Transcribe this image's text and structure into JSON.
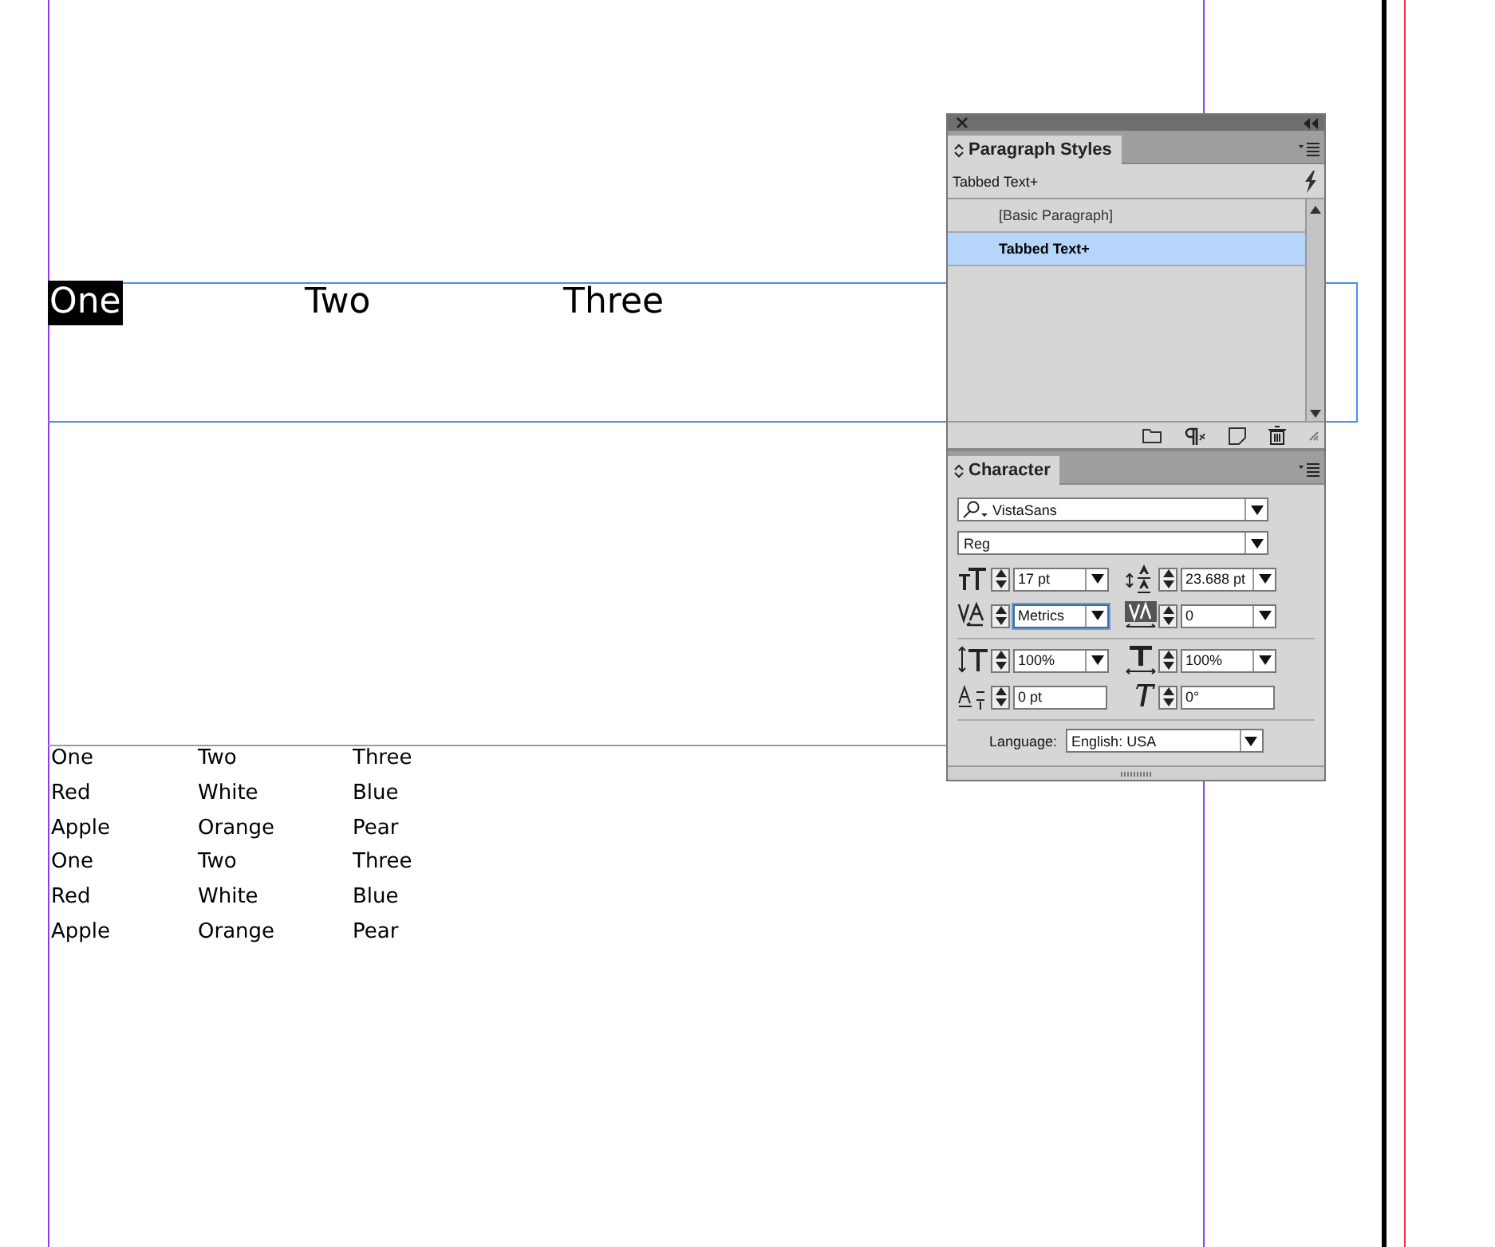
{
  "heading_frame": {
    "cells": [
      {
        "text": "One",
        "selected": true
      },
      {
        "text": "Two",
        "selected": false
      },
      {
        "text": "Three",
        "selected": false
      }
    ]
  },
  "body_text": {
    "rows": [
      [
        "One",
        "Two",
        "Three"
      ],
      [
        "Red",
        "White",
        "Blue"
      ],
      [
        "Apple",
        "Orange",
        "Pear"
      ],
      [
        "One",
        "Two",
        "Three"
      ],
      [
        "Red",
        "White",
        "Blue"
      ],
      [
        "Apple",
        "Orange",
        "Pear"
      ]
    ]
  },
  "paragraph_styles": {
    "tab": "Paragraph Styles",
    "current": "Tabbed Text+",
    "styles": [
      {
        "name": "[Basic Paragraph]",
        "selected": false
      },
      {
        "name": "Tabbed Text+",
        "selected": true
      }
    ]
  },
  "character": {
    "tab": "Character",
    "font_family": "VistaSans",
    "font_style": "Reg",
    "fields": [
      {
        "value": "17 pt",
        "dropdown": true,
        "focused": false
      },
      {
        "value": "23.688 pt",
        "dropdown": true,
        "focused": false
      },
      {
        "value": "Metrics",
        "dropdown": true,
        "focused": true
      },
      {
        "value": "0",
        "dropdown": true,
        "focused": false
      },
      {
        "value": "100%",
        "dropdown": true,
        "focused": false
      },
      {
        "value": "100%",
        "dropdown": true,
        "focused": false
      },
      {
        "value": "0 pt",
        "dropdown": false,
        "focused": false
      },
      {
        "value": "0°",
        "dropdown": false,
        "focused": false
      }
    ],
    "language_label": "Language:",
    "language": "English: USA"
  }
}
